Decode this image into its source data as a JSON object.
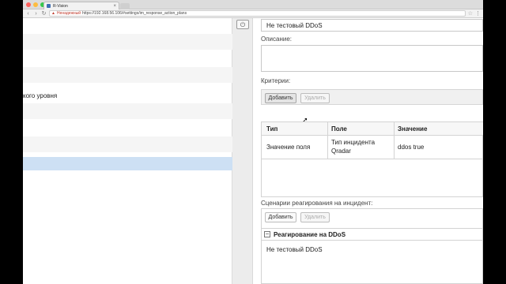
{
  "browser": {
    "tab_title": "R-Vision",
    "tab_close": "×",
    "security_label": "Ненадежный",
    "url": "https://192.168.56.106/#settings/ m_response_action_plans",
    "url_display": "https://192.168.56.106/#settings/im_response_action_plans"
  },
  "left_list": {
    "rows": [
      {
        "text": ""
      },
      {
        "text": ""
      },
      {
        "text": ""
      },
      {
        "text": ""
      },
      {
        "text": "кого уровня"
      },
      {
        "text": ""
      },
      {
        "text": ""
      },
      {
        "text": ""
      },
      {
        "text": ""
      }
    ]
  },
  "form": {
    "name_value": "Не тестовый DDoS",
    "description_label": "Описание:",
    "criteria_label": "Критерии:",
    "add_label": "Добавить",
    "remove_label": "Удалить",
    "criteria_table": {
      "columns": [
        "Тип",
        "Поле",
        "Значение"
      ],
      "rows": [
        {
          "type": "Значение поля",
          "field_line1": "Тип инцидента",
          "field_line2": "Qradar",
          "value": "ddos true"
        }
      ]
    },
    "scenarios_label": "Сценарии реагирования на инцидент:",
    "scenario_group": {
      "title": "Реагирование на DDoS",
      "collapse_symbol": "−",
      "item": "Не тестовый DDoS"
    }
  },
  "colors": {
    "selection": "#cde0f4",
    "close_dot": "#fc605c",
    "min_dot": "#fdbc40",
    "max_dot": "#34c84a"
  }
}
